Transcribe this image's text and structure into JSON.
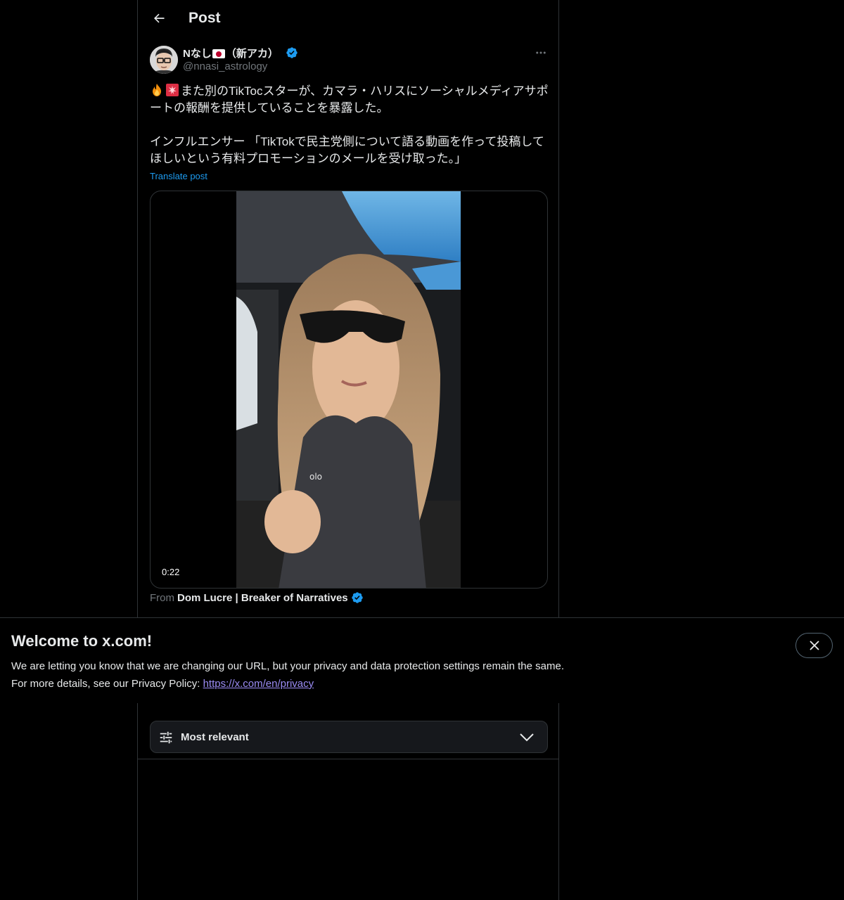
{
  "header": {
    "title": "Post"
  },
  "author": {
    "name": "Nなし",
    "name_suffix": "（新アカ）",
    "handle": "@nnasi_astrology",
    "verified": true
  },
  "post": {
    "paragraph_1": "また別のTikTocスターが、カマラ・ハリスにソーシャルメディアサポートの報酬を提供していることを暴露した。",
    "paragraph_2": "インフルエンサー 「TikTokで民主党側について語る動画を作って投稿してほしいという有料プロモーションのメールを受け取った。」",
    "translate_label": "Translate post"
  },
  "media": {
    "duration": "0:22"
  },
  "source": {
    "prefix": "From",
    "name": "Dom Lucre | Breaker of Narratives"
  },
  "banner": {
    "title": "Welcome to x.com!",
    "line_1": "We are letting you know that we are changing our URL, but your privacy and data protection settings remain the same.",
    "line_2_prefix": "For more details, see our Privacy Policy: ",
    "link_text": "https://x.com/en/privacy"
  },
  "sort": {
    "selected": "Most relevant"
  },
  "colors": {
    "accent": "#1d9bf0",
    "link_in_banner": "#9b8cf5",
    "background": "#000000",
    "border": "#2f3336"
  }
}
